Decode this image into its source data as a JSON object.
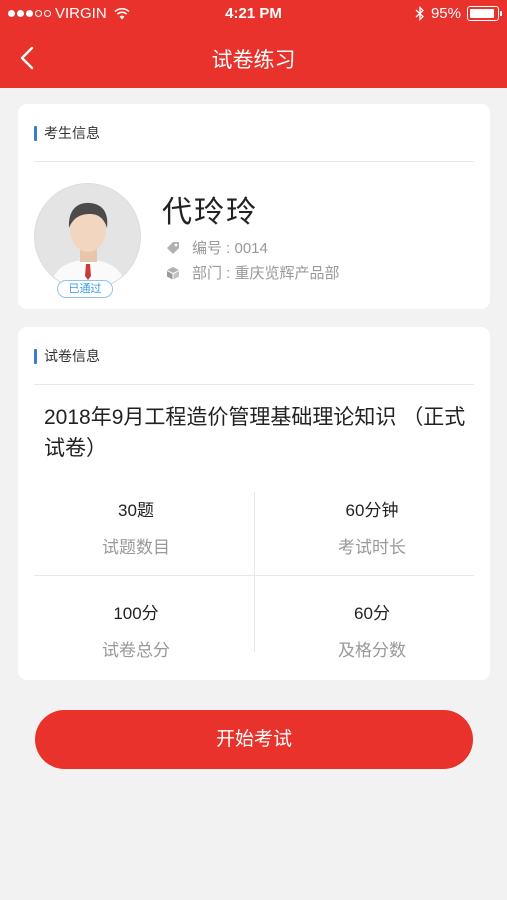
{
  "status_bar": {
    "carrier": "VIRGIN",
    "time": "4:21 PM",
    "battery": "95%"
  },
  "nav": {
    "title": "试卷练习"
  },
  "candidate": {
    "section_title": "考生信息",
    "name": "代玲玲",
    "id_text": "编号 : 0014",
    "dept_text": "部门 : 重庆览辉产品部",
    "badge": "已通过"
  },
  "exam": {
    "section_title": "试卷信息",
    "title": "2018年9月工程造价管理基础理论知识 （正式试卷）",
    "stats": [
      {
        "value": "30题",
        "label": "试题数目"
      },
      {
        "value": "60分钟",
        "label": "考试时长"
      },
      {
        "value": "100分",
        "label": "试卷总分"
      },
      {
        "value": "60分",
        "label": "及格分数"
      }
    ]
  },
  "actions": {
    "start_label": "开始考试"
  },
  "colors": {
    "brand_red": "#e8322b",
    "accent_blue": "#3a7bd5",
    "badge_blue": "#3a9be8"
  }
}
